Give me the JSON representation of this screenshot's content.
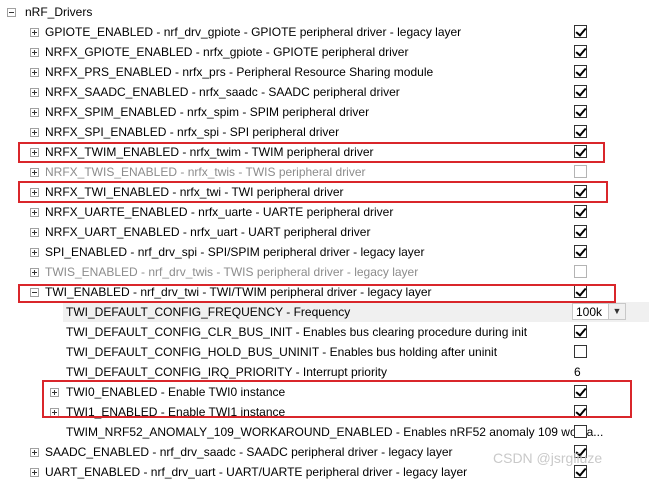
{
  "root": {
    "label": "nRF_Drivers",
    "expander": "minus"
  },
  "rows": [
    {
      "label": "GPIOTE_ENABLED - nrf_drv_gpiote - GPIOTE peripheral driver - legacy layer",
      "checked": true,
      "disabled": false
    },
    {
      "label": "NRFX_GPIOTE_ENABLED - nrfx_gpiote - GPIOTE peripheral driver",
      "checked": true,
      "disabled": false
    },
    {
      "label": "NRFX_PRS_ENABLED - nrfx_prs - Peripheral Resource Sharing module",
      "checked": true,
      "disabled": false
    },
    {
      "label": "NRFX_SAADC_ENABLED - nrfx_saadc - SAADC peripheral driver",
      "checked": true,
      "disabled": false
    },
    {
      "label": "NRFX_SPIM_ENABLED - nrfx_spim - SPIM peripheral driver",
      "checked": true,
      "disabled": false
    },
    {
      "label": "NRFX_SPI_ENABLED - nrfx_spi - SPI peripheral driver",
      "checked": true,
      "disabled": false
    },
    {
      "label": "NRFX_TWIM_ENABLED - nrfx_twim - TWIM peripheral driver",
      "checked": true,
      "disabled": false
    },
    {
      "label": "NRFX_TWIS_ENABLED - nrfx_twis - TWIS peripheral driver",
      "checked": false,
      "disabled": true
    },
    {
      "label": "NRFX_TWI_ENABLED - nrfx_twi - TWI peripheral driver",
      "checked": true,
      "disabled": false
    },
    {
      "label": "NRFX_UARTE_ENABLED - nrfx_uarte - UARTE peripheral driver",
      "checked": true,
      "disabled": false
    },
    {
      "label": "NRFX_UART_ENABLED - nrfx_uart - UART peripheral driver",
      "checked": true,
      "disabled": false
    },
    {
      "label": "SPI_ENABLED - nrf_drv_spi - SPI/SPIM peripheral driver - legacy layer",
      "checked": true,
      "disabled": false
    },
    {
      "label": "TWIS_ENABLED - nrf_drv_twis - TWIS peripheral driver - legacy layer",
      "checked": false,
      "disabled": true
    },
    {
      "label": "TWI_ENABLED - nrf_drv_twi - TWI/TWIM peripheral driver - legacy layer",
      "checked": true,
      "disabled": false
    }
  ],
  "twi_children": [
    {
      "label": "TWI_DEFAULT_CONFIG_FREQUENCY  - Frequency",
      "control": "dropdown",
      "value": "100k"
    },
    {
      "label": "TWI_DEFAULT_CONFIG_CLR_BUS_INIT  - Enables bus clearing procedure during init",
      "control": "checkbox",
      "checked": true
    },
    {
      "label": "TWI_DEFAULT_CONFIG_HOLD_BUS_UNINIT  - Enables bus holding after uninit",
      "control": "checkbox",
      "checked": false
    },
    {
      "label": "TWI_DEFAULT_CONFIG_IRQ_PRIORITY  - Interrupt priority",
      "control": "value",
      "value": "6"
    },
    {
      "label": "TWI0_ENABLED - Enable TWI0 instance",
      "control": "checkbox",
      "checked": true,
      "expander": "plus"
    },
    {
      "label": "TWI1_ENABLED - Enable TWI1 instance",
      "control": "checkbox",
      "checked": true,
      "expander": "plus"
    },
    {
      "label": "TWIM_NRF52_ANOMALY_109_WORKAROUND_ENABLED  - Enables nRF52 anomaly 109 worka...",
      "control": "checkbox",
      "checked": false
    }
  ],
  "after_rows": [
    {
      "label": "SAADC_ENABLED - nrf_drv_saadc - SAADC peripheral driver - legacy layer",
      "checked": true
    },
    {
      "label": "UART_ENABLED - nrf_drv_uart - UART/UARTE peripheral driver - legacy layer",
      "checked": true
    }
  ],
  "watermark": "CSDN @jsrgliuze",
  "highlight_color": "#d9262b"
}
